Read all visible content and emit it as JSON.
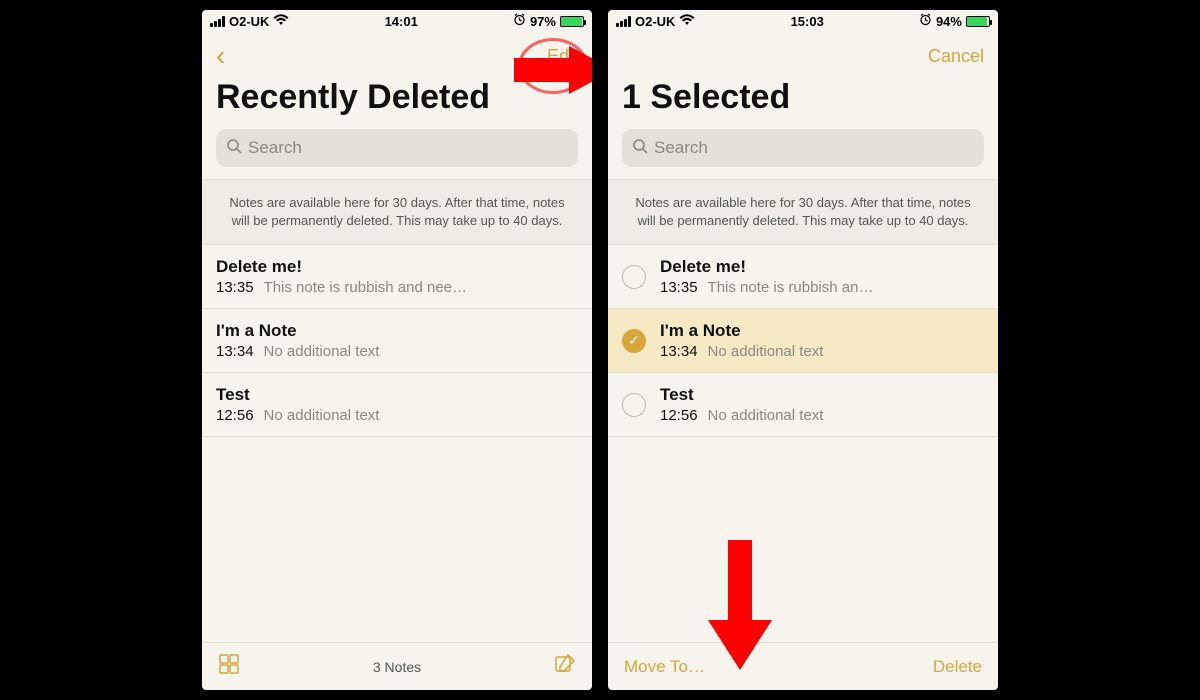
{
  "left": {
    "status": {
      "carrier": "O2-UK",
      "time": "14:01",
      "battery_pct": "97%"
    },
    "nav": {
      "edit": "Edit"
    },
    "title": "Recently Deleted",
    "search_placeholder": "Search",
    "banner": "Notes are available here for 30 days. After that time, notes will be permanently deleted. This may take up to 40 days.",
    "notes": [
      {
        "title": "Delete me!",
        "time": "13:35",
        "preview": "This note is rubbish and nee…"
      },
      {
        "title": "I'm a Note",
        "time": "13:34",
        "preview": "No additional text"
      },
      {
        "title": "Test",
        "time": "12:56",
        "preview": "No additional text"
      }
    ],
    "footer_count": "3 Notes"
  },
  "right": {
    "status": {
      "carrier": "O2-UK",
      "time": "15:03",
      "battery_pct": "94%"
    },
    "nav": {
      "cancel": "Cancel"
    },
    "title": "1 Selected",
    "search_placeholder": "Search",
    "banner": "Notes are available here for 30 days. After that time, notes will be permanently deleted. This may take up to 40 days.",
    "notes": [
      {
        "title": "Delete me!",
        "time": "13:35",
        "preview": "This note is rubbish an…",
        "selected": false
      },
      {
        "title": "I'm a Note",
        "time": "13:34",
        "preview": "No additional text",
        "selected": true
      },
      {
        "title": "Test",
        "time": "12:56",
        "preview": "No additional text",
        "selected": false
      }
    ],
    "toolbar": {
      "move": "Move To…",
      "delete": "Delete"
    }
  },
  "colors": {
    "accent": "#d9a63c",
    "annotation": "#ff0000"
  }
}
